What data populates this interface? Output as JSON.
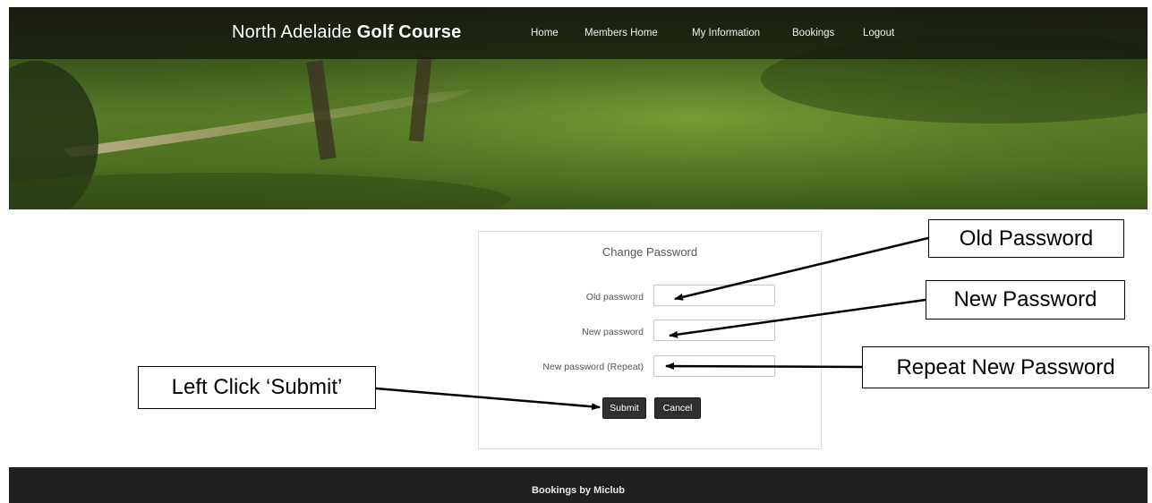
{
  "header": {
    "brand_prefix": "North Adelaide ",
    "brand_bold": "Golf Course",
    "nav": [
      "Home",
      "Members Home",
      "My Information",
      "Bookings",
      "Logout"
    ]
  },
  "form": {
    "title": "Change Password",
    "fields": [
      {
        "label": "Old password",
        "value": ""
      },
      {
        "label": "New password",
        "value": ""
      },
      {
        "label": "New password (Repeat)",
        "value": ""
      }
    ],
    "submit_label": "Submit",
    "cancel_label": "Cancel"
  },
  "callouts": {
    "old_password": "Old Password",
    "new_password": "New Password",
    "repeat_new_password": "Repeat New Password",
    "left_click_submit": "Left Click ‘Submit’"
  },
  "footer": {
    "text": "Bookings by Miclub"
  },
  "colors": {
    "nav_bg": "#12120e",
    "button_bg": "#2f2f2f",
    "footer_bg": "#202020",
    "grass": "#5b7e28"
  }
}
